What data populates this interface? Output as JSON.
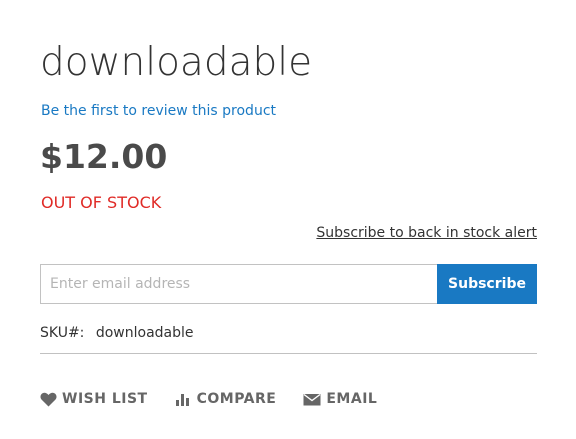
{
  "product": {
    "title": "downloadable",
    "review_link": "Be the first to review this product",
    "price": "$12.00",
    "stock_status": "OUT OF STOCK",
    "stock_alert_link": "Subscribe to back in stock alert",
    "sku_label": "SKU#:",
    "sku_value": "downloadable"
  },
  "subscribe_form": {
    "email_placeholder": "Enter email address",
    "email_value": "",
    "button_label": "Subscribe"
  },
  "actions": {
    "wishlist_label": "WISH LIST",
    "compare_label": "COMPARE",
    "email_label": "EMAIL"
  },
  "colors": {
    "link": "#1979c3",
    "stock_out": "#e02b27",
    "button_bg": "#1979c3",
    "text": "#333333",
    "action_text": "#666666"
  },
  "icons": [
    "heart-icon",
    "compare-bars-icon",
    "envelope-icon"
  ]
}
